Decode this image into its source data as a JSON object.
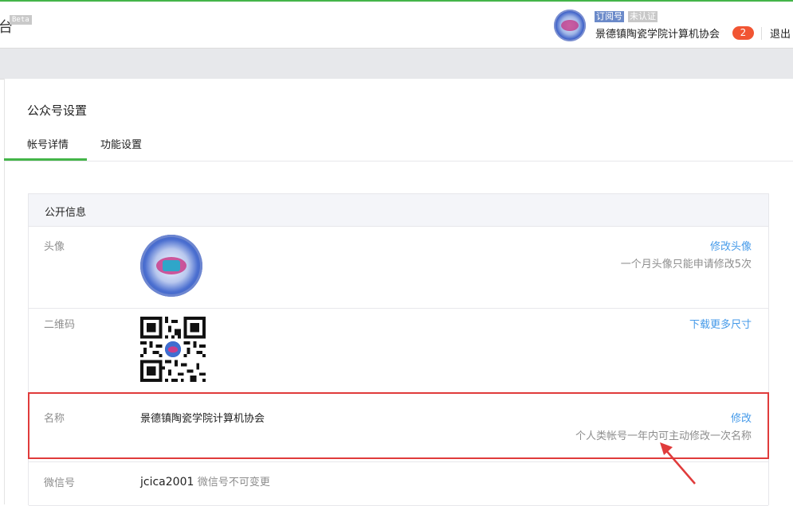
{
  "header": {
    "brand": "台",
    "beta": "Beta",
    "tag_subscription": "订阅号",
    "tag_unverified": "未认证",
    "account_name": "景德镇陶瓷学院计算机协会",
    "notification_count": "2",
    "logout": "退出"
  },
  "page": {
    "title": "公众号设置",
    "tabs": [
      {
        "label": "帐号详情",
        "active": true
      },
      {
        "label": "功能设置",
        "active": false
      }
    ]
  },
  "card": {
    "heading": "公开信息",
    "rows": {
      "avatar": {
        "label": "头像",
        "action": "修改头像",
        "tip": "一个月头像只能申请修改5次"
      },
      "qrcode": {
        "label": "二维码",
        "action": "下载更多尺寸"
      },
      "name": {
        "label": "名称",
        "value": "景德镇陶瓷学院计算机协会",
        "action": "修改",
        "tip": "个人类帐号一年内可主动修改一次名称"
      },
      "wechat_id": {
        "label": "微信号",
        "value": "jcica2001",
        "note": "微信号不可变更"
      }
    }
  },
  "colors": {
    "accent_green": "#44b549",
    "link_blue": "#459ae9",
    "badge_red": "#f15533",
    "highlight_red": "#e03b3b"
  }
}
